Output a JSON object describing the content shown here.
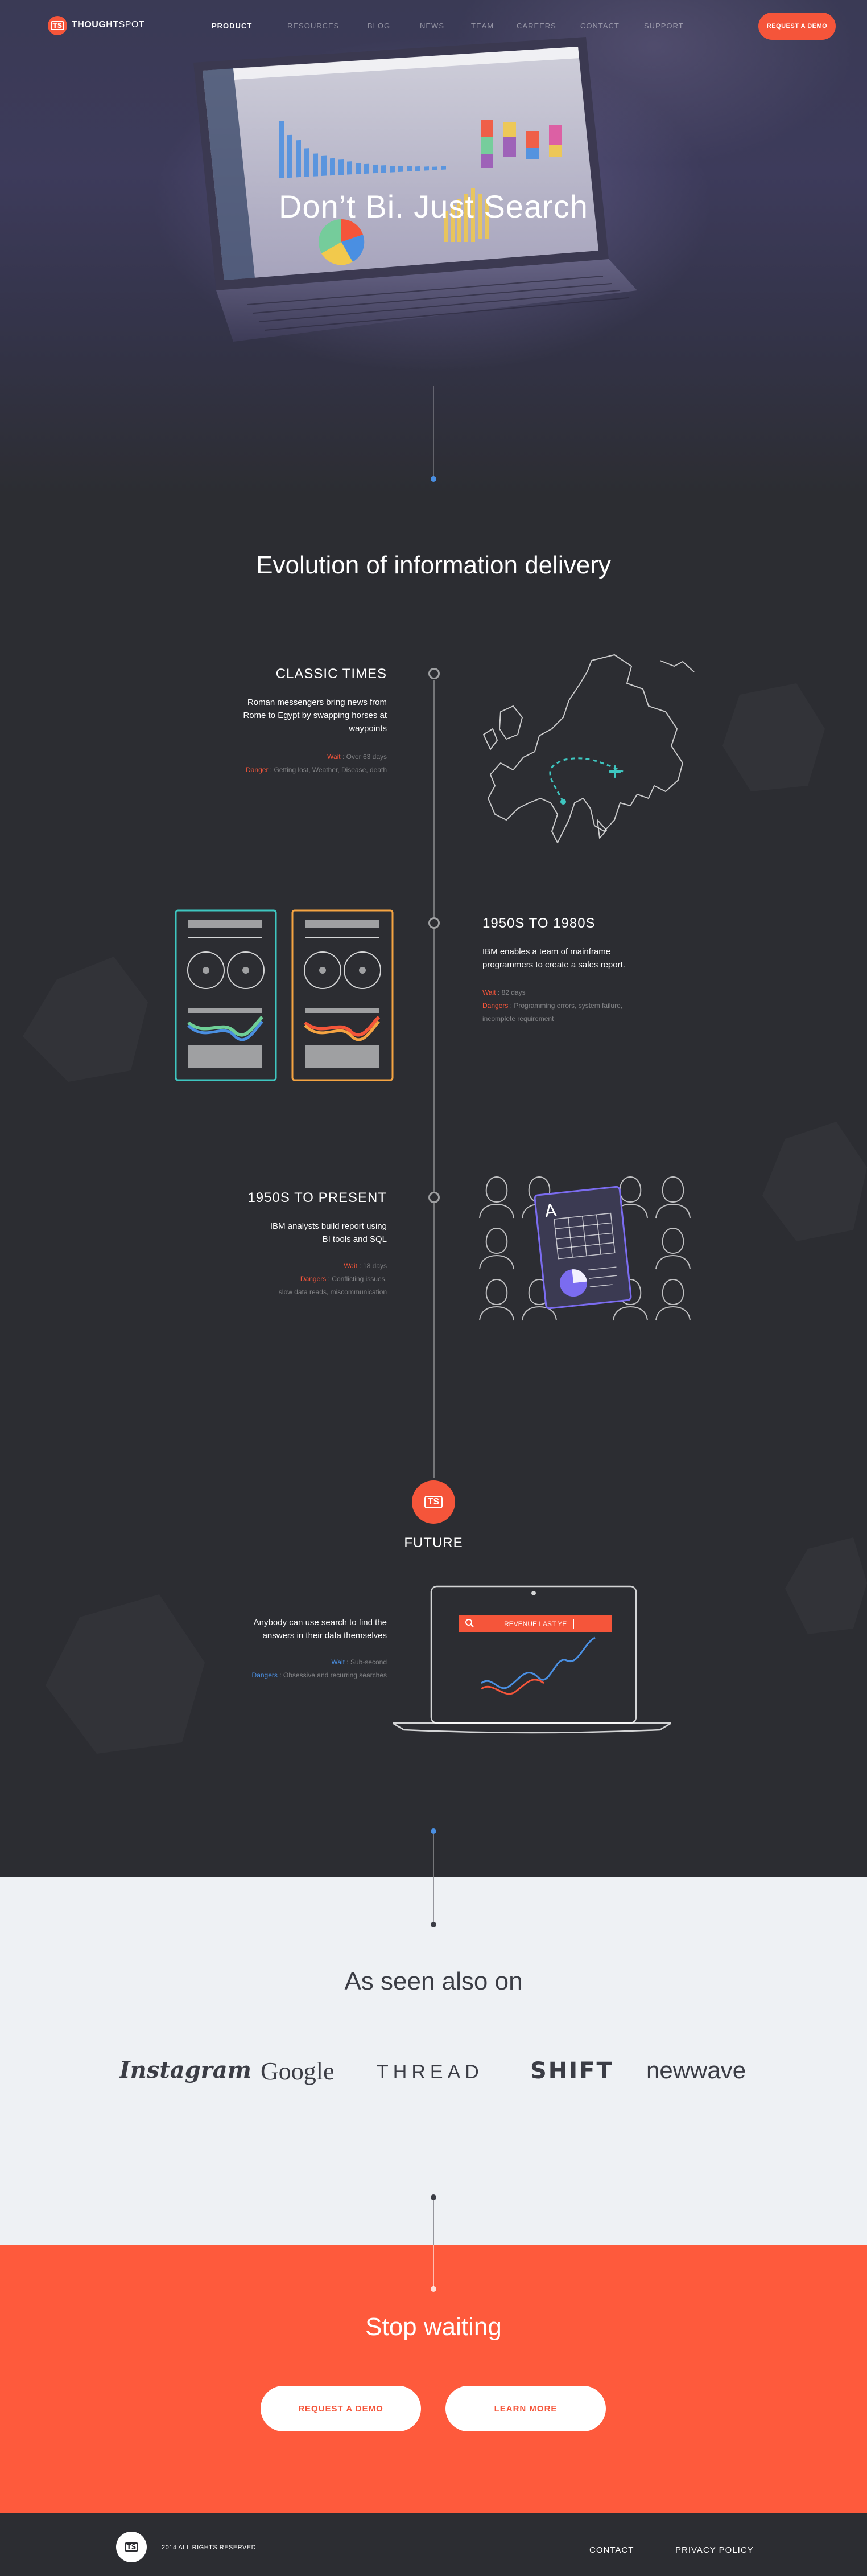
{
  "nav": {
    "brand_bold": "THOUGHT",
    "brand_thin": "SPOT",
    "logo_text": "TS",
    "items": [
      {
        "label": "PRODUCT"
      },
      {
        "label": "RESOURCES"
      },
      {
        "label": "BLOG"
      },
      {
        "label": "NEWS"
      },
      {
        "label": "TEAM"
      },
      {
        "label": "CAREERS"
      },
      {
        "label": "CONTACT"
      },
      {
        "label": "SUPPORT"
      }
    ],
    "cta_label": "REQUEST A DEMO"
  },
  "hero": {
    "title": "Don’t Bi. Just Search"
  },
  "evolution": {
    "title": "Evolution of information delivery",
    "eras": [
      {
        "title": "CLASSIC TIMES",
        "desc_lines": [
          "Roman messengers bring news from",
          "Rome to Egypt by swapping horses at",
          "waypoints"
        ],
        "wait_label": "Wait",
        "wait_value": " : Over 63 days",
        "danger_label": "Danger",
        "danger_value": " : Getting lost, Weather, Disease, death"
      },
      {
        "title": "1950s TO 1980s",
        "desc_lines": [
          "IBM enables a team of mainframe",
          "programmers to create a sales report."
        ],
        "wait_label": "Wait",
        "wait_value": " : 82 days",
        "danger_label": "Dangers",
        "danger_value": " : Programming errors, system failure,",
        "danger_value_2": "incomplete requirement"
      },
      {
        "title": "1950s TO PRESENT",
        "desc_lines": [
          "IBM analysts build report using",
          "BI tools and SQL"
        ],
        "wait_label": "Wait",
        "wait_value": " : 18 days",
        "danger_label": "Dangers",
        "danger_value": " : Conflicting issues,",
        "danger_value_2": "slow data reads, miscommunication"
      }
    ],
    "future": {
      "badge_text": "TS",
      "title": "FUTURE",
      "desc_lines": [
        "Anybody can use search to find the",
        "answers in their data themselves"
      ],
      "wait_label": "Wait",
      "wait_value": " : Sub-second",
      "danger_label": "Dangers",
      "danger_value": " : Obsessive and recurring searches",
      "search_text": "REVENUE LAST YE",
      "map_letter": "A"
    }
  },
  "press": {
    "title": "As seen also on",
    "logos": [
      "Instagram",
      "Google",
      "THREAD",
      "SHIFT",
      "newwave"
    ]
  },
  "cta": {
    "title": "Stop waiting",
    "primary_label": "REQUEST A DEMO",
    "secondary_label": "LEARN MORE"
  },
  "footer": {
    "logo_text": "TS",
    "copyright": "2014 ALL RIGHTS RESERVED",
    "links": [
      {
        "label": "CONTACT"
      },
      {
        "label": "PRIVACY POLICY"
      }
    ]
  },
  "colors": {
    "accent": "#f5553a",
    "blue": "#4a8fe2",
    "teal": "#3ec6c0",
    "dark": "#2c2d32",
    "light": "#eef1f4"
  }
}
